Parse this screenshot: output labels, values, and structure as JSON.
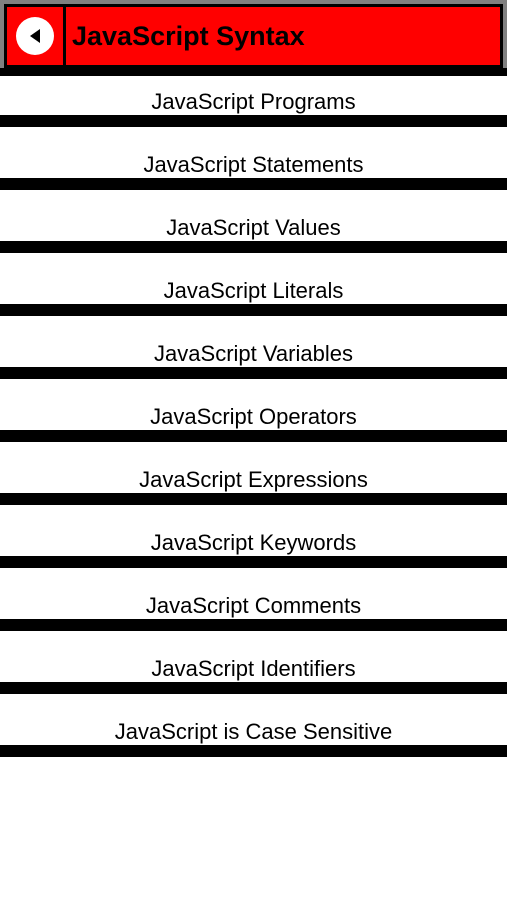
{
  "header": {
    "title": "JavaScript Syntax",
    "back_icon": "back-arrow-icon",
    "accent_color": "#ff0000"
  },
  "menu": {
    "items": [
      {
        "label": "JavaScript Programs"
      },
      {
        "label": "JavaScript Statements"
      },
      {
        "label": "JavaScript Values"
      },
      {
        "label": "JavaScript Literals"
      },
      {
        "label": "JavaScript Variables"
      },
      {
        "label": "JavaScript Operators"
      },
      {
        "label": "JavaScript Expressions"
      },
      {
        "label": "JavaScript Keywords"
      },
      {
        "label": "JavaScript Comments"
      },
      {
        "label": "JavaScript Identifiers"
      },
      {
        "label": "JavaScript is Case Sensitive"
      }
    ]
  }
}
